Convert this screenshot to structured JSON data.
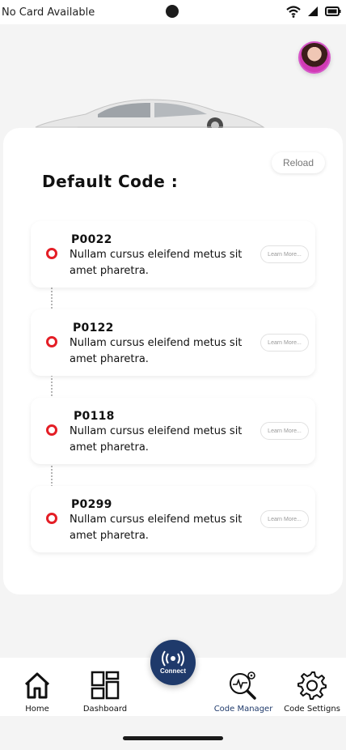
{
  "status_bar": {
    "text": "No Card Available"
  },
  "reload_label": "Reload",
  "title": "Default Code :",
  "codes": [
    {
      "code": "P0022",
      "description": "Nullam cursus eleifend metus sit amet pharetra.",
      "button": "Learn More..."
    },
    {
      "code": "P0122",
      "description": "Nullam cursus eleifend metus sit amet pharetra.",
      "button": "Learn More..."
    },
    {
      "code": "P0118",
      "description": "Nullam cursus eleifend metus sit amet pharetra.",
      "button": "Learn More..."
    },
    {
      "code": "P0299",
      "description": "Nullam cursus eleifend metus sit amet pharetra.",
      "button": "Learn More..."
    }
  ],
  "nav": {
    "home": "Home",
    "dashboard": "Dashboard",
    "connect": "Connect",
    "code_manager": "Code Manager",
    "code_settings": "Code Settigns"
  },
  "colors": {
    "accent": "#1f3a6b",
    "timeline_dot": "#e41e26",
    "background": "#f4f4f4"
  },
  "icons": [
    "wifi-icon",
    "signal-icon",
    "battery-icon",
    "home-icon",
    "dashboard-icon",
    "connect-icon",
    "code-manager-icon",
    "settings-icon"
  ]
}
